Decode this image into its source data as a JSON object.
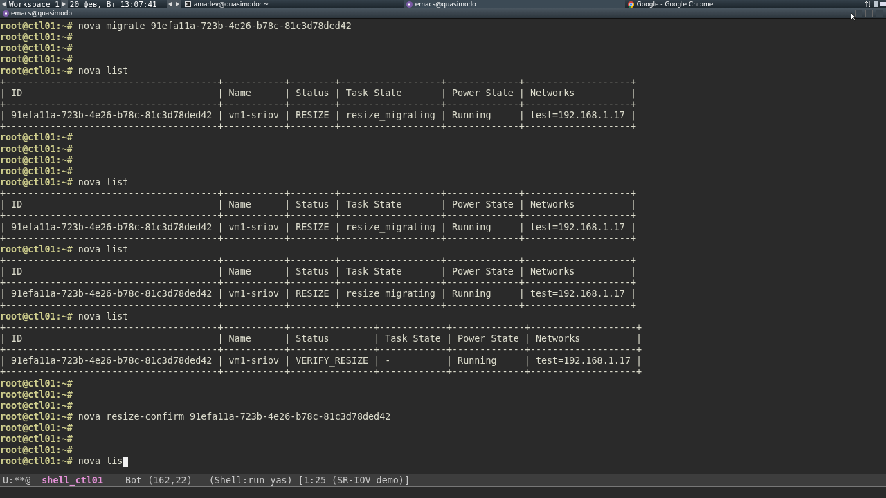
{
  "taskbar": {
    "workspace": "Workspace 1",
    "clock": "20 фев, Вт 13:07:41",
    "tasks": [
      {
        "label": "amadev@quasimodo: ~",
        "kind": "terminal",
        "selected": false
      },
      {
        "label": "emacs@quasimodo",
        "kind": "emacs",
        "selected": true
      },
      {
        "label": "Google - Google Chrome",
        "kind": "chrome",
        "selected": false
      }
    ]
  },
  "window": {
    "title": "emacs@quasimodo"
  },
  "terminal": {
    "lines": [
      {
        "kind": "prompt",
        "prompt": "root@ctl01:~#",
        "command": "nova migrate 91efa11a-723b-4e26-b78c-81c3d78ded42"
      },
      {
        "kind": "prompt",
        "prompt": "root@ctl01:~#"
      },
      {
        "kind": "prompt",
        "prompt": "root@ctl01:~#"
      },
      {
        "kind": "prompt",
        "prompt": "root@ctl01:~#"
      },
      {
        "kind": "prompt",
        "prompt": "root@ctl01:~#",
        "command": "nova list"
      },
      {
        "kind": "output",
        "text": "+--------------------------------------+-----------+--------+------------------+-------------+-------------------+"
      },
      {
        "kind": "output",
        "text": "| ID                                   | Name      | Status | Task State       | Power State | Networks          |"
      },
      {
        "kind": "output",
        "text": "+--------------------------------------+-----------+--------+------------------+-------------+-------------------+"
      },
      {
        "kind": "output",
        "text": "| 91efa11a-723b-4e26-b78c-81c3d78ded42 | vm1-sriov | RESIZE | resize_migrating | Running     | test=192.168.1.17 |"
      },
      {
        "kind": "output",
        "text": "+--------------------------------------+-----------+--------+------------------+-------------+-------------------+"
      },
      {
        "kind": "prompt",
        "prompt": "root@ctl01:~#"
      },
      {
        "kind": "prompt",
        "prompt": "root@ctl01:~#"
      },
      {
        "kind": "prompt",
        "prompt": "root@ctl01:~#"
      },
      {
        "kind": "prompt",
        "prompt": "root@ctl01:~#"
      },
      {
        "kind": "prompt",
        "prompt": "root@ctl01:~#",
        "command": "nova list"
      },
      {
        "kind": "output",
        "text": "+--------------------------------------+-----------+--------+------------------+-------------+-------------------+"
      },
      {
        "kind": "output",
        "text": "| ID                                   | Name      | Status | Task State       | Power State | Networks          |"
      },
      {
        "kind": "output",
        "text": "+--------------------------------------+-----------+--------+------------------+-------------+-------------------+"
      },
      {
        "kind": "output",
        "text": "| 91efa11a-723b-4e26-b78c-81c3d78ded42 | vm1-sriov | RESIZE | resize_migrating | Running     | test=192.168.1.17 |"
      },
      {
        "kind": "output",
        "text": "+--------------------------------------+-----------+--------+------------------+-------------+-------------------+"
      },
      {
        "kind": "prompt",
        "prompt": "root@ctl01:~#",
        "command": "nova list"
      },
      {
        "kind": "output",
        "text": "+--------------------------------------+-----------+--------+------------------+-------------+-------------------+"
      },
      {
        "kind": "output",
        "text": "| ID                                   | Name      | Status | Task State       | Power State | Networks          |"
      },
      {
        "kind": "output",
        "text": "+--------------------------------------+-----------+--------+------------------+-------------+-------------------+"
      },
      {
        "kind": "output",
        "text": "| 91efa11a-723b-4e26-b78c-81c3d78ded42 | vm1-sriov | RESIZE | resize_migrating | Running     | test=192.168.1.17 |"
      },
      {
        "kind": "output",
        "text": "+--------------------------------------+-----------+--------+------------------+-------------+-------------------+"
      },
      {
        "kind": "prompt",
        "prompt": "root@ctl01:~#",
        "command": "nova list"
      },
      {
        "kind": "output",
        "text": "+--------------------------------------+-----------+---------------+------------+-------------+-------------------+"
      },
      {
        "kind": "output",
        "text": "| ID                                   | Name      | Status        | Task State | Power State | Networks          |"
      },
      {
        "kind": "output",
        "text": "+--------------------------------------+-----------+---------------+------------+-------------+-------------------+"
      },
      {
        "kind": "output",
        "text": "| 91efa11a-723b-4e26-b78c-81c3d78ded42 | vm1-sriov | VERIFY_RESIZE | -          | Running     | test=192.168.1.17 |"
      },
      {
        "kind": "output",
        "text": "+--------------------------------------+-----------+---------------+------------+-------------+-------------------+"
      },
      {
        "kind": "prompt",
        "prompt": "root@ctl01:~#"
      },
      {
        "kind": "prompt",
        "prompt": "root@ctl01:~#"
      },
      {
        "kind": "prompt",
        "prompt": "root@ctl01:~#"
      },
      {
        "kind": "prompt",
        "prompt": "root@ctl01:~#",
        "command": "nova resize-confirm 91efa11a-723b-4e26-b78c-81c3d78ded42"
      },
      {
        "kind": "prompt",
        "prompt": "root@ctl01:~#"
      },
      {
        "kind": "prompt",
        "prompt": "root@ctl01:~#"
      },
      {
        "kind": "prompt",
        "prompt": "root@ctl01:~#"
      },
      {
        "kind": "input",
        "prompt": "root@ctl01:~#",
        "command": "nova lis"
      }
    ]
  },
  "mode_line": {
    "status": "U:**@",
    "buffer": "shell_ctl01",
    "position": "Bot (162,22)",
    "modes": "(Shell:run yas) [1:25 (SR-IOV demo)]"
  }
}
